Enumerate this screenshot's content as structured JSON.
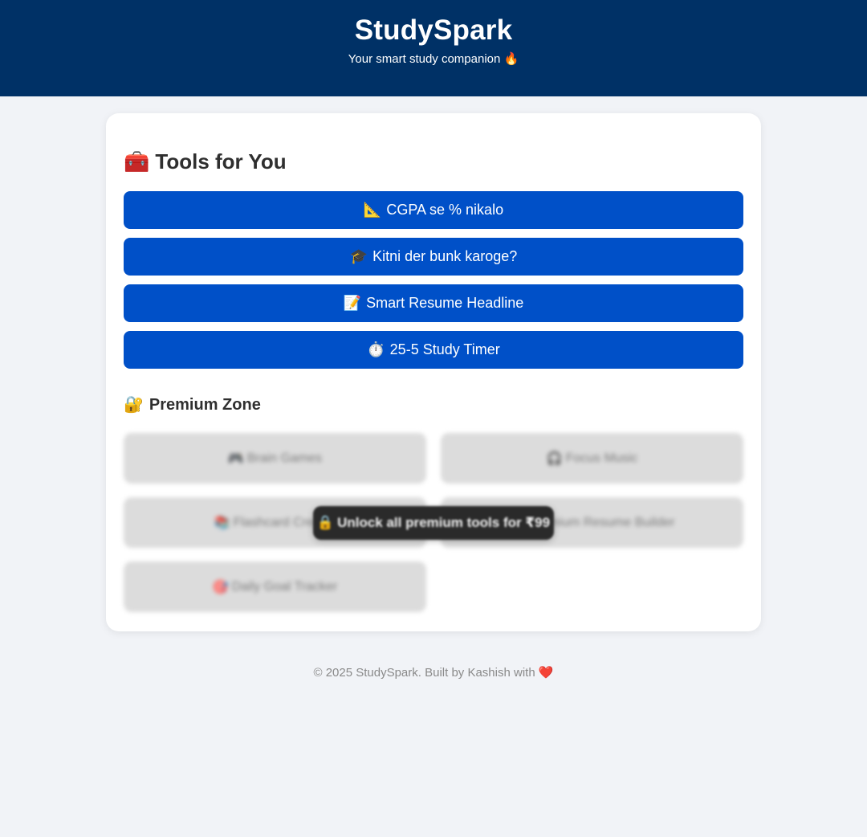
{
  "header": {
    "title": "StudySpark",
    "tagline": "Your smart study companion",
    "tagline_emoji": "🔥"
  },
  "tools": {
    "heading_emoji": "🧰",
    "heading": "Tools for You",
    "buttons": [
      {
        "emoji": "📐",
        "label": "CGPA se % nikalo"
      },
      {
        "emoji": "🎓",
        "label": "Kitni der bunk karoge?"
      },
      {
        "emoji": "📝",
        "label": "Smart Resume Headline"
      },
      {
        "emoji": "⏱️",
        "label": "25-5 Study Timer"
      }
    ]
  },
  "premium": {
    "heading_emoji": "🔐",
    "heading": "Premium Zone",
    "items": [
      {
        "emoji": "🎮",
        "label": "Brain Games"
      },
      {
        "emoji": "🎧",
        "label": "Focus Music"
      },
      {
        "emoji": "📚",
        "label": "Flashcard Creator"
      },
      {
        "emoji": "📄",
        "label": "Premium Resume Builder"
      },
      {
        "emoji": "🎯",
        "label": "Daily Goal Tracker"
      }
    ],
    "unlock_emoji": "🔒",
    "unlock_text": "Unlock all premium tools for ₹99"
  },
  "footer": {
    "text": "© 2025 StudySpark. Built by Kashish with",
    "emoji": "❤️"
  },
  "colors": {
    "header_bg": "#003166",
    "button_bg": "#0050c8",
    "page_bg": "#f1f3f7"
  }
}
